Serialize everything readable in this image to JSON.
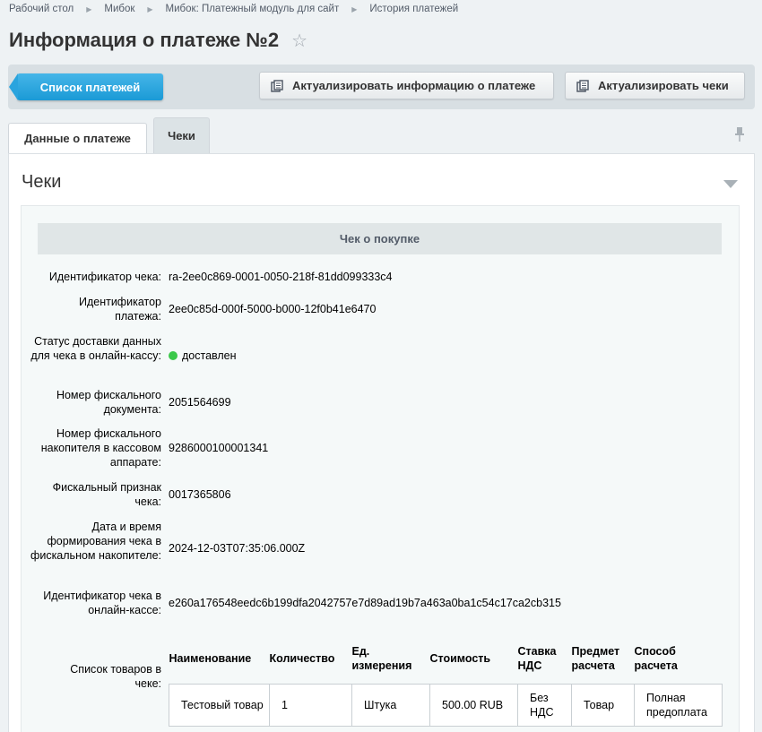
{
  "breadcrumb": [
    "Рабочий стол",
    "Мибок",
    "Мибок: Платежный модуль для сайт",
    "История платежей"
  ],
  "page": {
    "title": "Информация о платеже №2"
  },
  "toolbar": {
    "list_label": "Список платежей",
    "actualize_info_label": "Актуализировать информацию о платеже",
    "actualize_checks_label": "Актуализировать чеки"
  },
  "tabs": {
    "data": "Данные о платеже",
    "checks": "Чеки"
  },
  "panel": {
    "title": "Чеки"
  },
  "receipt": {
    "header": "Чек о покупке",
    "fields": [
      {
        "label": "Идентификатор чека:",
        "value": "ra-2ee0c869-0001-0050-218f-81dd099333c4"
      },
      {
        "label": "Идентификатор платежа:",
        "value": "2ee0c85d-000f-5000-b000-12f0b41e6470"
      },
      {
        "label": "Статус доставки данных для чека в онлайн-кассу:",
        "value": "доставлен",
        "status_color": "#3bc84a"
      },
      {
        "label": "Номер фискального документа:",
        "value": "2051564699"
      },
      {
        "label": "Номер фискального накопителя в кассовом аппарате:",
        "value": "9286000100001341"
      },
      {
        "label": "Фискальный признак чека:",
        "value": "0017365806"
      },
      {
        "label": "Дата и время формирования чека в фискальном накопителе:",
        "value": "2024-12-03T07:35:06.000Z"
      },
      {
        "label": "Идентификатор чека в онлайн-кассе:",
        "value": "e260a176548eedc6b199dfa2042757e7d89ad19b7a463a0ba1c54c17ca2cb315"
      }
    ],
    "products_label": "Список товаров в чеке:",
    "products_columns": [
      "Наименование",
      "Количество",
      "Ед. измерения",
      "Стоимость",
      "Ставка НДС",
      "Предмет расчета",
      "Способ расчета"
    ],
    "products_rows": [
      [
        "Тестовый товар",
        "1",
        "Штука",
        "500.00 RUB",
        "Без НДС",
        "Товар",
        "Полная предоплата"
      ]
    ]
  }
}
